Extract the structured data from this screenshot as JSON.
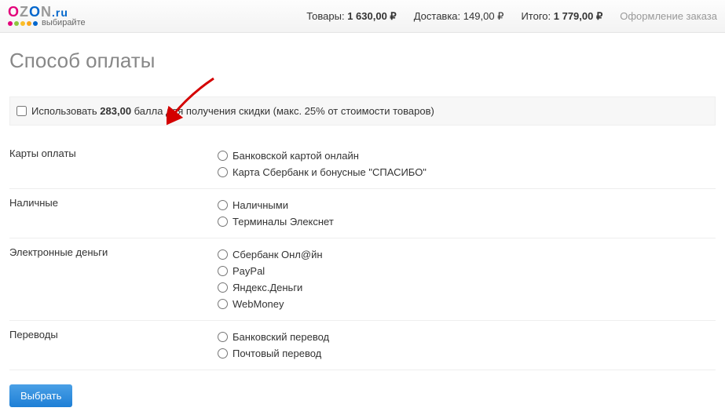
{
  "logo": {
    "tagline": "выбирайте"
  },
  "header": {
    "goods_label": "Товары:",
    "goods_value": "1 630,00",
    "delivery_label": "Доставка:",
    "delivery_value": "149,00",
    "total_label": "Итого:",
    "total_value": "1 779,00",
    "checkout": "Оформление заказа"
  },
  "title": "Способ оплаты",
  "bonus": {
    "prefix": "Использовать ",
    "amount": "283,00",
    "suffix": " балла для получения скидки (макс. 25% от стоимости товаров)"
  },
  "groups": [
    {
      "name": "Карты оплаты",
      "options": [
        "Банковской картой онлайн",
        "Карта Сбербанк и бонусные \"СПАСИБО\""
      ]
    },
    {
      "name": "Наличные",
      "options": [
        "Наличными",
        "Терминалы Элекснет"
      ]
    },
    {
      "name": "Электронные деньги",
      "options": [
        "Сбербанк Онл@йн",
        "PayPal",
        "Яндекс.Деньги",
        "WebMoney"
      ]
    },
    {
      "name": "Переводы",
      "options": [
        "Банковский перевод",
        "Почтовый перевод"
      ]
    }
  ],
  "submit": "Выбрать"
}
